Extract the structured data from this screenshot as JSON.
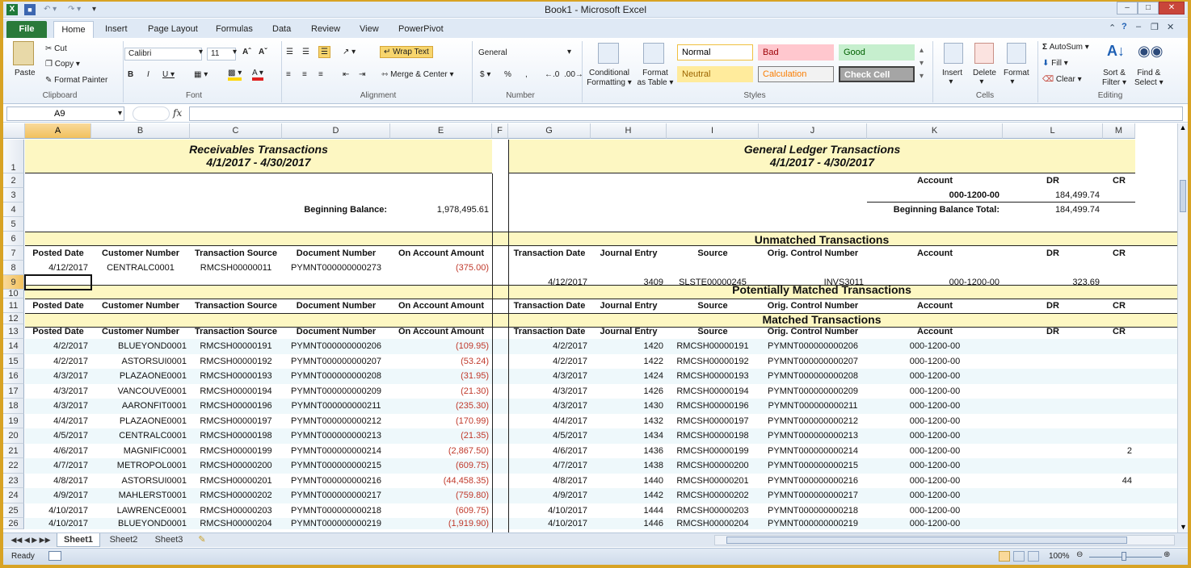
{
  "window": {
    "title": "Book1  -  Microsoft Excel",
    "app_icon": "X"
  },
  "tabs": [
    "File",
    "Home",
    "Insert",
    "Page Layout",
    "Formulas",
    "Data",
    "Review",
    "View",
    "PowerPivot"
  ],
  "ribbon": {
    "clipboard": {
      "paste": "Paste",
      "cut": "Cut",
      "copy": "Copy",
      "format_painter": "Format Painter",
      "label": "Clipboard"
    },
    "font": {
      "name": "Calibri",
      "size": "11",
      "label": "Font"
    },
    "alignment": {
      "wrap_text": "Wrap Text",
      "merge_center": "Merge & Center",
      "label": "Alignment"
    },
    "number": {
      "format": "General",
      "label": "Number"
    },
    "styles": {
      "conditional": [
        "Conditional",
        "Formatting"
      ],
      "format_table": [
        "Format",
        "as Table"
      ],
      "normal": "Normal",
      "bad": "Bad",
      "good": "Good",
      "neutral": "Neutral",
      "calculation": "Calculation",
      "check_cell": "Check Cell",
      "label": "Styles"
    },
    "cells": {
      "insert": "Insert",
      "delete": "Delete",
      "format": "Format",
      "label": "Cells"
    },
    "editing": {
      "autosum": "AutoSum",
      "fill": "Fill",
      "clear": "Clear",
      "sort": [
        "Sort &",
        "Filter"
      ],
      "find": [
        "Find &",
        "Select"
      ],
      "label": "Editing"
    }
  },
  "formula_bar": {
    "name_box": "A9",
    "fx": "fx",
    "value": ""
  },
  "columns": [
    "A",
    "B",
    "C",
    "D",
    "E",
    "F",
    "G",
    "H",
    "I",
    "J",
    "K",
    "L",
    "M"
  ],
  "rows_numbers": [
    "1",
    "2",
    "3",
    "4",
    "5",
    "6",
    "7",
    "8",
    "9",
    "10",
    "11",
    "12",
    "13",
    "14",
    "15",
    "16",
    "17",
    "18",
    "19",
    "20",
    "21",
    "22",
    "23",
    "24",
    "25",
    "26"
  ],
  "sheet": {
    "receivables_title": "Receivables Transactions",
    "receivables_dates": "4/1/2017 - 4/30/2017",
    "gl_title": "General Ledger Transactions",
    "gl_dates": "4/1/2017 - 4/30/2017",
    "account_label": "Account",
    "dr_label": "DR",
    "cr_label": "CR",
    "account_value": "000-1200-00",
    "account_dr": "184,499.74",
    "beginning_balance_label": "Beginning Balance:",
    "beginning_balance_value": "1,978,495.61",
    "beginning_balance_total_label": "Beginning Balance Total:",
    "beginning_balance_total_value": "184,499.74",
    "unmatched_title": "Unmatched Transactions",
    "potential_title": "Potentially Matched Transactions",
    "matched_title": "Matched Transactions",
    "left_headers": [
      "Posted Date",
      "Customer Number",
      "Transaction Source",
      "Document Number",
      "On Account Amount"
    ],
    "right_headers": [
      "Transaction Date",
      "Journal Entry",
      "Source",
      "Orig. Control Number",
      "Account",
      "DR",
      "CR"
    ],
    "unmatched_left": [
      "4/12/2017",
      "CENTRALC0001",
      "RMCSH00000011",
      "PYMNT000000000273",
      "(375.00)"
    ],
    "unmatched_right": [
      "4/12/2017",
      "3409",
      "SLSTE00000245",
      "INVS3011",
      "000-1200-00",
      "323.69",
      ""
    ],
    "matched": [
      [
        "4/2/2017",
        "BLUEYOND0001",
        "RMCSH00000191",
        "PYMNT000000000206",
        "(109.95)",
        "4/2/2017",
        "1420",
        "RMCSH00000191",
        "PYMNT000000000206",
        "000-1200-00",
        "",
        ""
      ],
      [
        "4/2/2017",
        "ASTORSUI0001",
        "RMCSH00000192",
        "PYMNT000000000207",
        "(53.24)",
        "4/2/2017",
        "1422",
        "RMCSH00000192",
        "PYMNT000000000207",
        "000-1200-00",
        "",
        ""
      ],
      [
        "4/3/2017",
        "PLAZAONE0001",
        "RMCSH00000193",
        "PYMNT000000000208",
        "(31.95)",
        "4/3/2017",
        "1424",
        "RMCSH00000193",
        "PYMNT000000000208",
        "000-1200-00",
        "",
        ""
      ],
      [
        "4/3/2017",
        "VANCOUVE0001",
        "RMCSH00000194",
        "PYMNT000000000209",
        "(21.30)",
        "4/3/2017",
        "1426",
        "RMCSH00000194",
        "PYMNT000000000209",
        "000-1200-00",
        "",
        ""
      ],
      [
        "4/3/2017",
        "AARONFIT0001",
        "RMCSH00000196",
        "PYMNT000000000211",
        "(235.30)",
        "4/3/2017",
        "1430",
        "RMCSH00000196",
        "PYMNT000000000211",
        "000-1200-00",
        "",
        ""
      ],
      [
        "4/4/2017",
        "PLAZAONE0001",
        "RMCSH00000197",
        "PYMNT000000000212",
        "(170.99)",
        "4/4/2017",
        "1432",
        "RMCSH00000197",
        "PYMNT000000000212",
        "000-1200-00",
        "",
        ""
      ],
      [
        "4/5/2017",
        "CENTRALC0001",
        "RMCSH00000198",
        "PYMNT000000000213",
        "(21.35)",
        "4/5/2017",
        "1434",
        "RMCSH00000198",
        "PYMNT000000000213",
        "000-1200-00",
        "",
        ""
      ],
      [
        "4/6/2017",
        "MAGNIFIC0001",
        "RMCSH00000199",
        "PYMNT000000000214",
        "(2,867.50)",
        "4/6/2017",
        "1436",
        "RMCSH00000199",
        "PYMNT000000000214",
        "000-1200-00",
        "",
        "2"
      ],
      [
        "4/7/2017",
        "METROPOL0001",
        "RMCSH00000200",
        "PYMNT000000000215",
        "(609.75)",
        "4/7/2017",
        "1438",
        "RMCSH00000200",
        "PYMNT000000000215",
        "000-1200-00",
        "",
        ""
      ],
      [
        "4/8/2017",
        "ASTORSUI0001",
        "RMCSH00000201",
        "PYMNT000000000216",
        "(44,458.35)",
        "4/8/2017",
        "1440",
        "RMCSH00000201",
        "PYMNT000000000216",
        "000-1200-00",
        "",
        "44"
      ],
      [
        "4/9/2017",
        "MAHLERST0001",
        "RMCSH00000202",
        "PYMNT000000000217",
        "(759.80)",
        "4/9/2017",
        "1442",
        "RMCSH00000202",
        "PYMNT000000000217",
        "000-1200-00",
        "",
        ""
      ],
      [
        "4/10/2017",
        "LAWRENCE0001",
        "RMCSH00000203",
        "PYMNT000000000218",
        "(609.75)",
        "4/10/2017",
        "1444",
        "RMCSH00000203",
        "PYMNT000000000218",
        "000-1200-00",
        "",
        ""
      ],
      [
        "4/10/2017",
        "BLUEYOND0001",
        "RMCSH00000204",
        "PYMNT000000000219",
        "(1,919.90)",
        "4/10/2017",
        "1446",
        "RMCSH00000204",
        "PYMNT000000000219",
        "000-1200-00",
        "",
        ""
      ]
    ]
  },
  "sheet_tabs": [
    "Sheet1",
    "Sheet2",
    "Sheet3"
  ],
  "status": {
    "ready": "Ready",
    "zoom": "100%"
  }
}
